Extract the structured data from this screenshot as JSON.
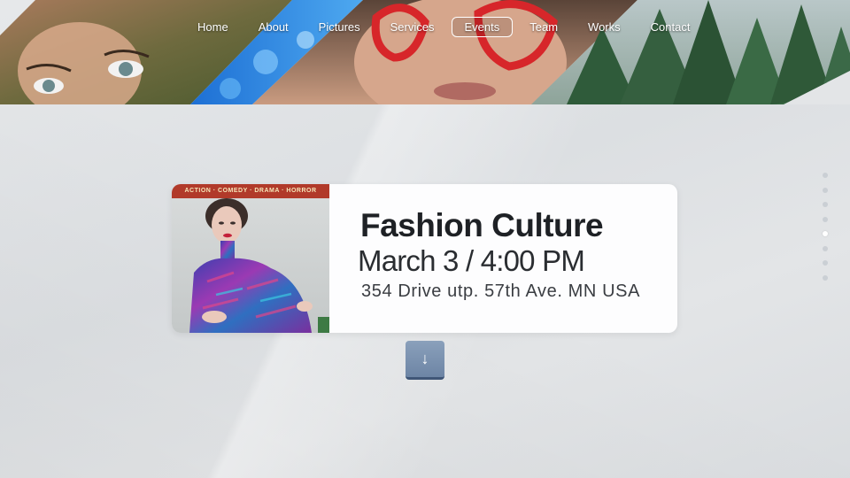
{
  "nav": {
    "items": [
      {
        "label": "Home",
        "active": false
      },
      {
        "label": "About",
        "active": false
      },
      {
        "label": "Pictures",
        "active": false
      },
      {
        "label": "Services",
        "active": false
      },
      {
        "label": "Events",
        "active": true
      },
      {
        "label": "Team",
        "active": false
      },
      {
        "label": "Works",
        "active": false
      },
      {
        "label": "Contact",
        "active": false
      }
    ]
  },
  "event": {
    "poster_caption": "ACTION · COMEDY · DRAMA · HORROR",
    "title": "Fashion Culture",
    "date": "March 3 / 4:00 PM",
    "address": "354 Drive utp. 57th Ave. MN USA"
  },
  "scroll_button": {
    "icon": "arrow-down-icon",
    "glyph": "↓"
  },
  "section_dots": {
    "count": 8,
    "active_index": 4
  },
  "colors": {
    "accent": "#7890ad",
    "card_background": "#fdfdfe",
    "page_background": "#e1e3e5"
  }
}
